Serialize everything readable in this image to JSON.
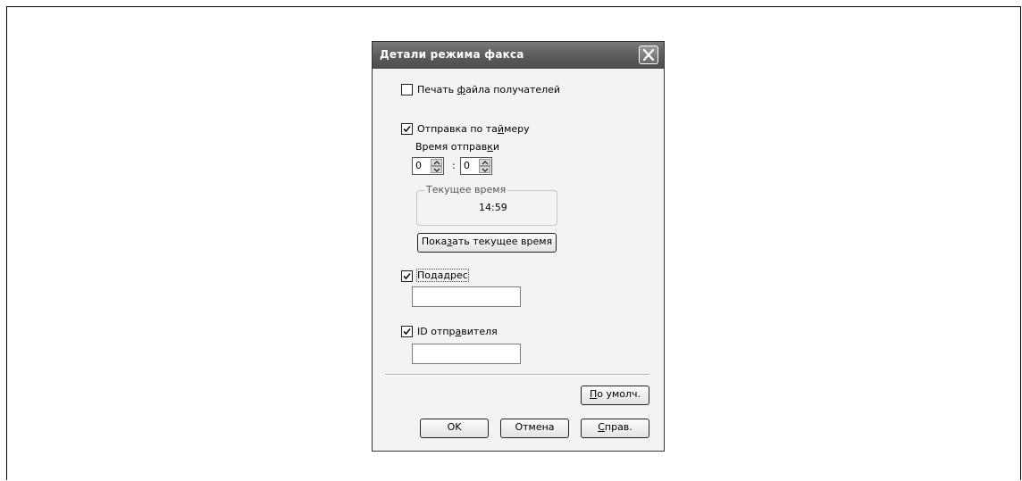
{
  "dialog": {
    "title": "Детали режима факса",
    "close_icon": "close-icon"
  },
  "options": {
    "print_recipients": {
      "label_pre": "Печать ",
      "label_u": "ф",
      "label_post": "айла получателей",
      "checked": false
    },
    "timer_send": {
      "label_pre": "Отправка по та",
      "label_u": "й",
      "label_post": "меру",
      "checked": true
    },
    "send_time_label_pre": "Время отправ",
    "send_time_label_u": "к",
    "send_time_label_post": "и",
    "hours": "0",
    "separator": ":",
    "minutes": "0",
    "current_time_group": "Текущее время",
    "current_time": "14:59",
    "show_time_button": {
      "pre": "Пока",
      "u": "з",
      "post": "ать текущее время"
    },
    "subaddress": {
      "label_pre": "По",
      "label_u": "д",
      "label_post": "адрес",
      "checked": true,
      "value": ""
    },
    "sender_id": {
      "label_pre": "ID отпр",
      "label_u": "а",
      "label_post": "вителя",
      "checked": true,
      "value": ""
    }
  },
  "buttons": {
    "default": {
      "u": "П",
      "post": "о умолч."
    },
    "ok": "OK",
    "cancel": "Отмена",
    "help": {
      "u": "С",
      "post": "прав."
    }
  }
}
